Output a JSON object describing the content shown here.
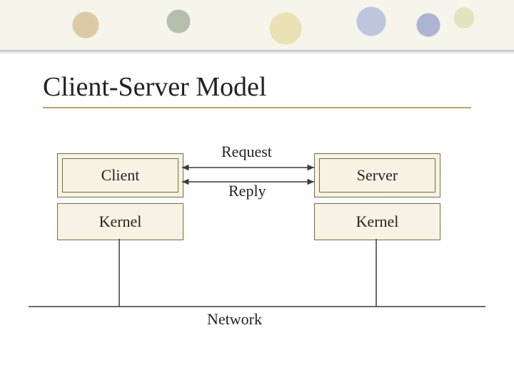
{
  "title": "Client-Server Model",
  "boxes": {
    "client": "Client",
    "server": "Server",
    "left_kernel": "Kernel",
    "right_kernel": "Kernel"
  },
  "arrows": {
    "request": "Request",
    "reply": "Reply"
  },
  "network": "Network"
}
